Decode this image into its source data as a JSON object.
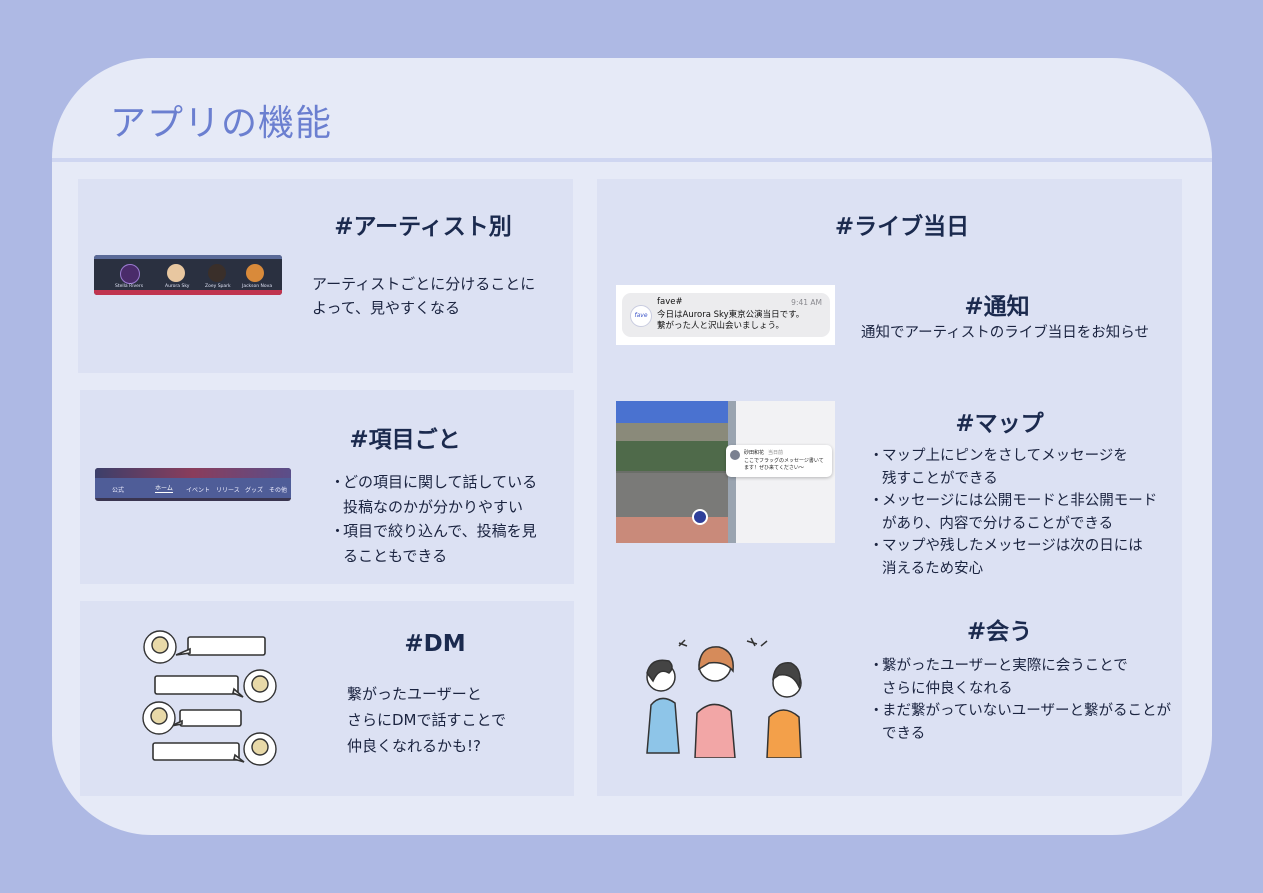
{
  "page": {
    "title": "アプリの機能"
  },
  "artist": {
    "heading": "#アーティスト別",
    "lines": [
      "アーティストごとに分けることに",
      "よって、見やすくなる"
    ],
    "strip_names": [
      "Stella Rivers",
      "Aurora Sky",
      "Zoey Spark",
      "Jackson Nova"
    ]
  },
  "topic": {
    "heading": "#項目ごと",
    "bullets": [
      [
        "どの項目に関して話している",
        "投稿なのかが分かりやすい"
      ],
      [
        "項目で絞り込んで、投稿を見",
        "ることもできる"
      ]
    ],
    "tabs": [
      "公式",
      "ホーム",
      "イベント",
      "リリース",
      "グッズ",
      "その他"
    ]
  },
  "dm": {
    "heading": "#DM",
    "lines": [
      "繋がったユーザーと",
      "さらにDMで話すことで",
      "仲良くなれるかも!?"
    ]
  },
  "live": {
    "heading": "#ライブ当日",
    "notify": {
      "heading": "#通知",
      "text": "通知でアーティストのライブ当日をお知らせ",
      "notification": {
        "app": "fave#",
        "icon": "fave",
        "time": "9:41 AM",
        "line1": "今日はAurora Sky東京公演当日です。",
        "line2": "繋がった人と沢山会いましょう。"
      }
    },
    "map": {
      "heading": "#マップ",
      "bullets": [
        [
          "マップ上にピンをさしてメッセージを",
          "残すことができる"
        ],
        [
          "メッセージには公開モードと非公開モード",
          "があり、内容で分けることができる"
        ],
        [
          "マップや残したメッセージは次の日には",
          "消えるため安心"
        ]
      ],
      "popup": {
        "name": "砂田和花",
        "when": "当日前",
        "line1": "ここでフラッグのメッセージ書いて",
        "line2": "ます！ぜひ来てください〜"
      }
    },
    "meet": {
      "heading": "#会う",
      "bullets": [
        [
          "繋がったユーザーと実際に会うことで",
          "さらに仲良くなれる"
        ],
        [
          "まだ繋がっていないユーザーと繋がることが",
          "できる"
        ]
      ]
    }
  },
  "bullet_mark": "・",
  "colors": {
    "background": "#aeb9e4",
    "card": "#e6eaf7",
    "panel": "#dce1f3",
    "title": "#6b7fd0",
    "heading": "#1b2a4e"
  },
  "icons": [
    "user-avatar-icon",
    "chat-bubble-icon",
    "map-pin-icon",
    "people-talking-illustration"
  ]
}
